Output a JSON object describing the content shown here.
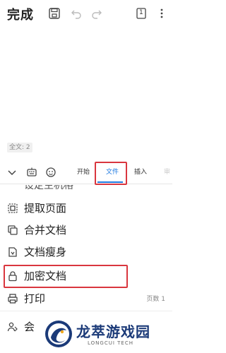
{
  "header": {
    "done_label": "完成",
    "page_count": "1"
  },
  "editor": {
    "word_count": "全文: 2"
  },
  "toolbar": {
    "tabs": [
      {
        "label": "开始"
      },
      {
        "label": "文件"
      },
      {
        "label": "插入"
      }
    ],
    "cut_tab_label": "审"
  },
  "menu": {
    "partial_label": "设定主机格",
    "items": [
      {
        "label": "提取页面",
        "icon": "extract-page-icon"
      },
      {
        "label": "合并文档",
        "icon": "merge-doc-icon"
      },
      {
        "label": "文档瘦身",
        "icon": "slim-doc-icon"
      },
      {
        "label": "加密文档",
        "icon": "lock-icon"
      },
      {
        "label": "打印",
        "icon": "printer-icon",
        "right": "页数 1"
      }
    ],
    "partial_bottom_label": "会"
  },
  "watermark": {
    "title": "龙萃游戏园",
    "subtitle": "LONGCUI TECH"
  },
  "colors": {
    "accent": "#1f7ae0",
    "highlight": "#d9363e",
    "brand": "#1b3a78"
  }
}
